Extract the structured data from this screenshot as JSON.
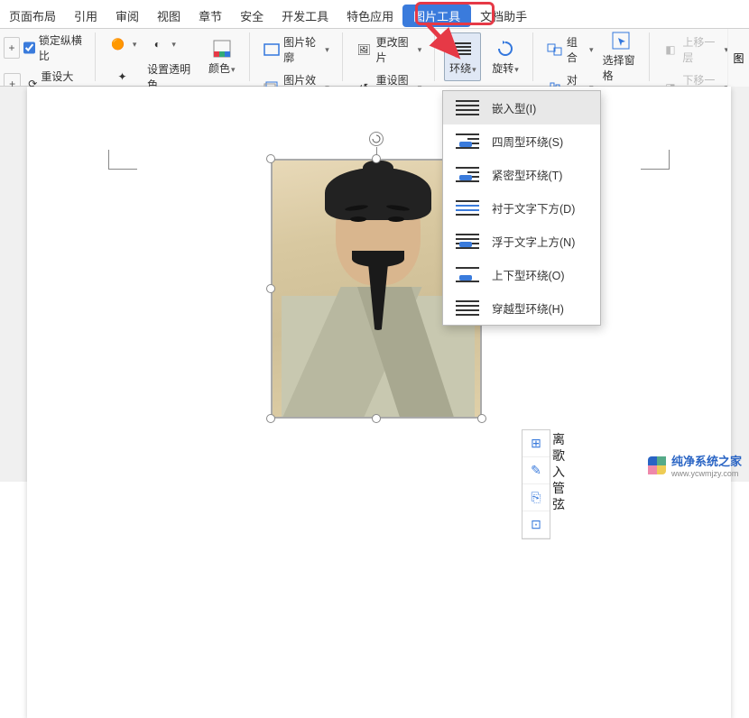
{
  "tabs": {
    "t1": "页面布局",
    "t2": "引用",
    "t3": "审阅",
    "t4": "视图",
    "t5": "章节",
    "t6": "安全",
    "t7": "开发工具",
    "t8": "特色应用",
    "t9_active": "图片工具",
    "t10": "文档助手"
  },
  "ribbon": {
    "lock_ratio": "锁定纵横比",
    "reset_size": "重设大小",
    "set_transparent": "设置透明色",
    "color": "颜色",
    "pic_outline": "图片轮廓",
    "pic_effect": "图片效果",
    "change_pic": "更改图片",
    "reset_pic": "重设图片",
    "wrap": "环绕",
    "rotate": "旋转",
    "group": "组合",
    "align": "对齐",
    "select_pane": "选择窗格",
    "move_up": "上移一层",
    "move_down": "下移一层",
    "crop_partial": "图"
  },
  "wrap_menu": {
    "m1": "嵌入型(I)",
    "m2": "四周型环绕(S)",
    "m3": "紧密型环绕(T)",
    "m4": "衬于文字下方(D)",
    "m5": "浮于文字上方(N)",
    "m6": "上下型环绕(O)",
    "m7": "穿越型环绕(H)"
  },
  "side_text": "离歌入管弦",
  "watermark": {
    "brand": "纯净系统之家",
    "url": "www.ycwmjzy.com"
  }
}
